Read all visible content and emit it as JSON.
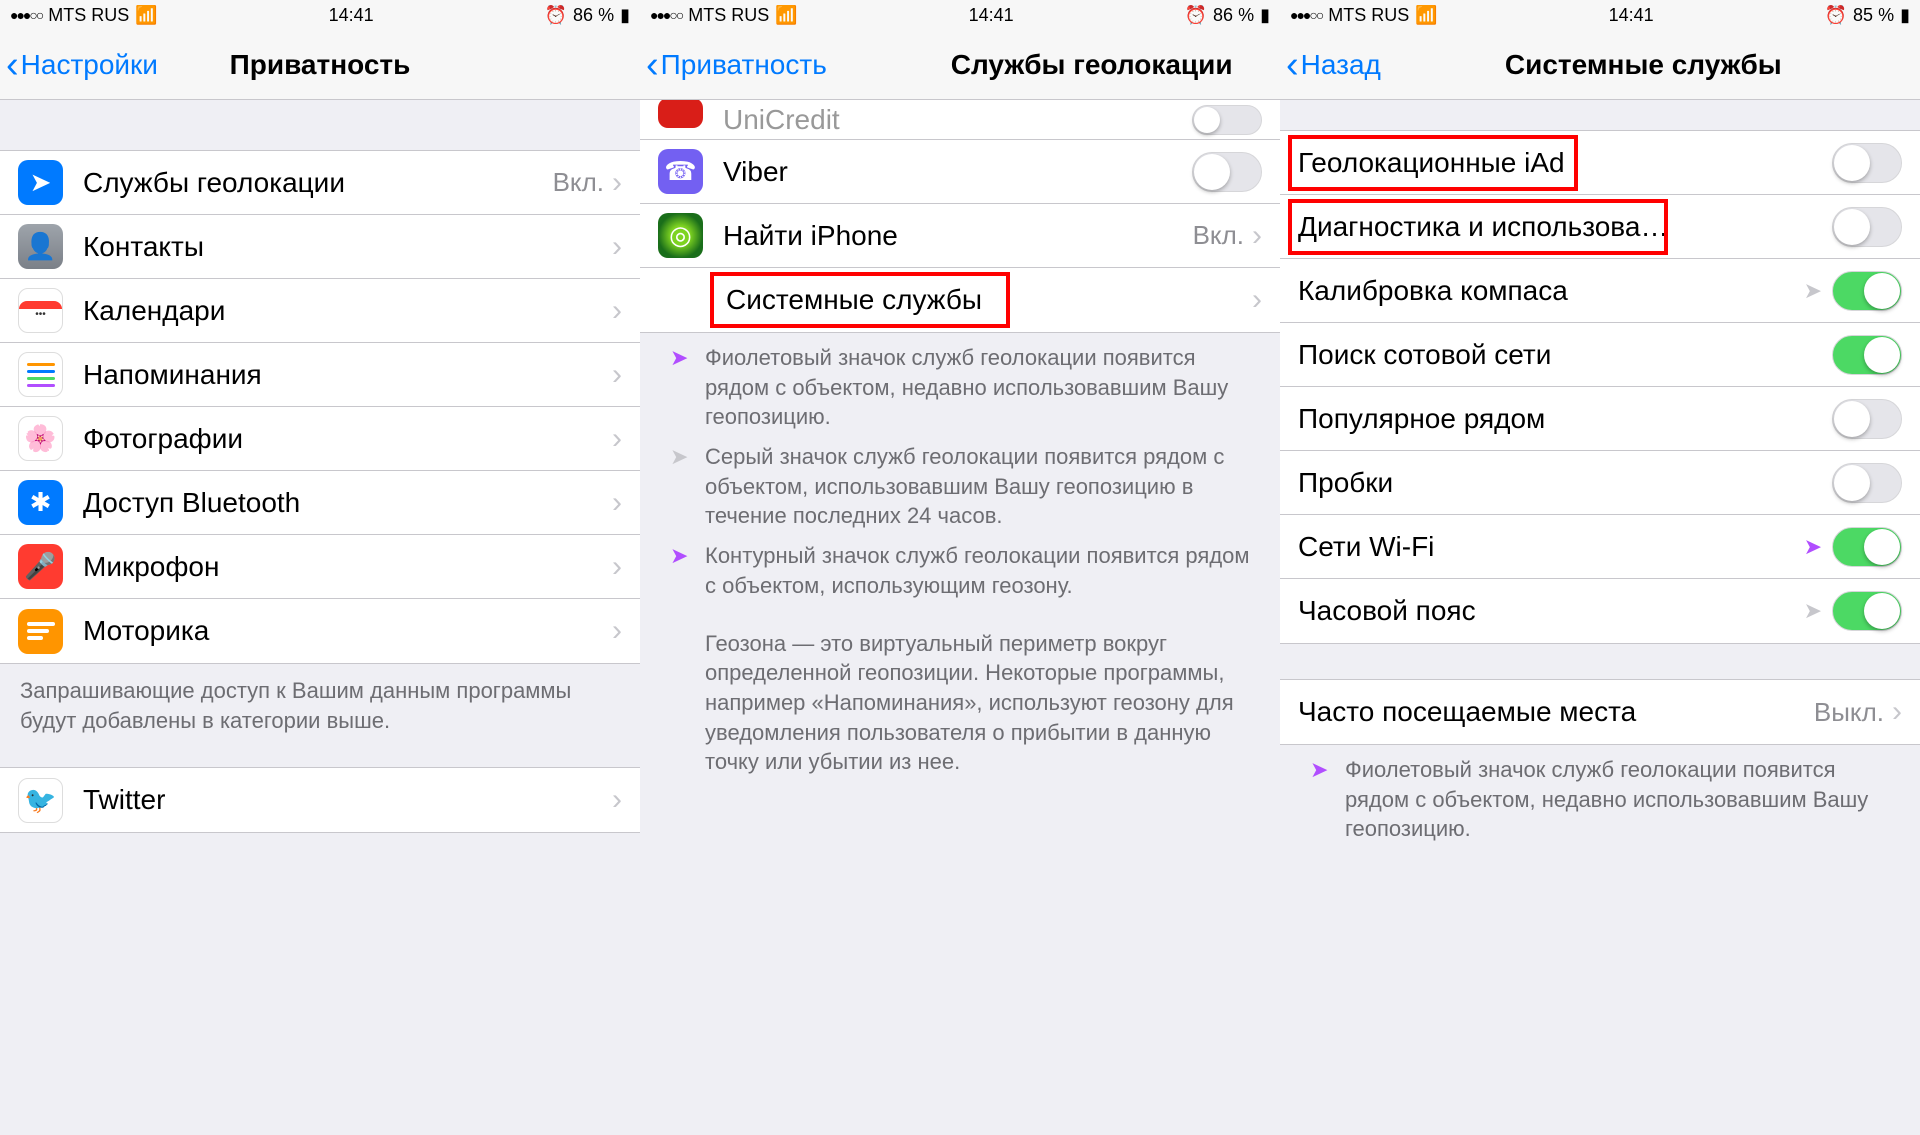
{
  "status": {
    "carrier": "MTS RUS",
    "time": "14:41",
    "alarm_icon": "⏰",
    "battery1": "86 %",
    "battery2": "86 %",
    "battery3": "85 %",
    "signal_dots": "●●●○○"
  },
  "screen1": {
    "back": "Настройки",
    "title": "Приватность",
    "items": [
      {
        "name": "location-services",
        "label": "Службы геолокации",
        "value": "Вкл.",
        "hasDisclosure": true,
        "highlight": true
      },
      {
        "name": "contacts",
        "label": "Контакты",
        "hasDisclosure": true
      },
      {
        "name": "calendars",
        "label": "Календари",
        "hasDisclosure": true
      },
      {
        "name": "reminders",
        "label": "Напоминания",
        "hasDisclosure": true
      },
      {
        "name": "photos",
        "label": "Фотографии",
        "hasDisclosure": true
      },
      {
        "name": "bluetooth",
        "label": "Доступ Bluetooth",
        "hasDisclosure": true
      },
      {
        "name": "microphone",
        "label": "Микрофон",
        "hasDisclosure": true
      },
      {
        "name": "motion",
        "label": "Моторика",
        "hasDisclosure": true
      }
    ],
    "footer": "Запрашивающие доступ к Вашим данным программы будут добавлены в категории выше.",
    "group2": [
      {
        "name": "twitter",
        "label": "Twitter",
        "hasDisclosure": true
      }
    ]
  },
  "screen2": {
    "back": "Приватность",
    "title": "Службы геолокации",
    "items": [
      {
        "name": "unicredit",
        "label": "UniCredit",
        "switch": false,
        "partial": true
      },
      {
        "name": "viber",
        "label": "Viber",
        "switch": false
      },
      {
        "name": "findiphone",
        "label": "Найти iPhone",
        "value": "Вкл.",
        "hasDisclosure": true
      },
      {
        "name": "system-services",
        "label": "Системные службы",
        "hasDisclosure": true,
        "indent": true,
        "highlight": true
      }
    ],
    "info": [
      {
        "bullet_class": "loc-purple",
        "bullet": "➤",
        "text": "Фиолетовый значок служб геолокации появится рядом с объектом, недавно использовавшим Вашу геопозицию."
      },
      {
        "bullet_class": "loc-gray",
        "bullet": "➤",
        "text": "Серый значок служб геолокации появится рядом с объектом, использовавшим Вашу геопозицию в течение последних 24 часов."
      },
      {
        "bullet_class": "loc-hollow-purple",
        "bullet": "➤",
        "text": "Контурный значок служб геолокации появится рядом с объектом, использующим геозону."
      },
      {
        "bullet_class": "",
        "bullet": "",
        "text": "Геозона — это виртуальный периметр вокруг определенной геопозиции. Некоторые программы, например «Напоминания», используют геозону для уведомления пользователя о прибытии в данную точку или убытии из нее."
      }
    ]
  },
  "screen3": {
    "back": "Назад",
    "title": "Системные службы",
    "items": [
      {
        "name": "geolocation-iad",
        "label": "Геолокационные iAd",
        "switch": false,
        "highlight": true
      },
      {
        "name": "diagnostics-usage",
        "label": "Диагностика и использова…",
        "switch": false,
        "highlight": true
      },
      {
        "name": "compass-calibration",
        "label": "Калибровка компаса",
        "switch": true,
        "ind": "gray"
      },
      {
        "name": "cell-network-search",
        "label": "Поиск сотовой сети",
        "switch": true
      },
      {
        "name": "popular-nearby",
        "label": "Популярное рядом",
        "switch": false
      },
      {
        "name": "traffic",
        "label": "Пробки",
        "switch": false
      },
      {
        "name": "wifi-networking",
        "label": "Сети Wi-Fi",
        "switch": true,
        "ind": "purple"
      },
      {
        "name": "timezone",
        "label": "Часовой пояс",
        "switch": true,
        "ind": "gray"
      }
    ],
    "group2": [
      {
        "name": "frequent-locations",
        "label": "Часто посещаемые места",
        "value": "Выкл.",
        "hasDisclosure": true
      }
    ],
    "footer_bullet": "➤",
    "footer": "Фиолетовый значок служб геолокации появится рядом с объектом, недавно использовавшим Вашу геопозицию."
  }
}
